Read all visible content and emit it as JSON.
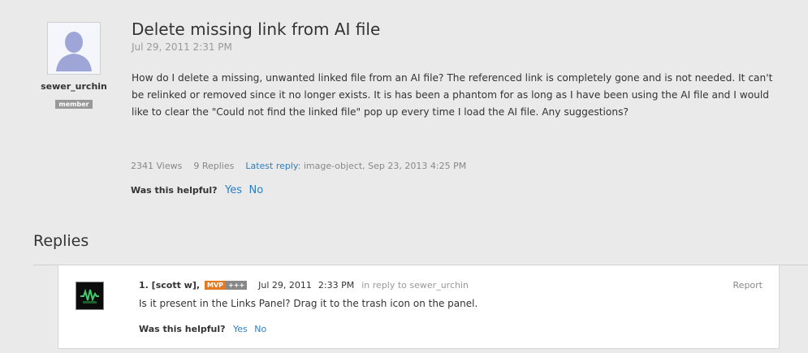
{
  "question": {
    "author": "sewer_urchin",
    "role_badge": "member",
    "title": "Delete missing link from AI file",
    "date": "Jul 29, 2011 2:31 PM",
    "body": "How do I delete a missing, unwanted linked file from an AI file? The referenced link is completely gone and is not needed. It can't be relinked or removed since it no longer exists. It is has been a phantom for as long as I have been using the AI file and I would like to clear the \"Could not find the linked file\" pop up every time I load the AI file. Any suggestions?",
    "views": "2341 Views",
    "replies_count": "9 Replies",
    "latest_reply_label": "Latest reply",
    "latest_reply_text": ": image-object, Sep 23, 2013 4:25 PM",
    "helpful_label": "Was this helpful?",
    "yes_label": "Yes",
    "no_label": "No"
  },
  "replies_section": {
    "heading": "Replies"
  },
  "reply": {
    "author": "1. [scott w],",
    "badge_mvp": "MVP",
    "badge_plus": "+++",
    "date": "Jul 29, 2011",
    "time": "2:33 PM",
    "in_reply_to": "in reply to sewer_urchin",
    "report_label": "Report",
    "body": "Is it present in the Links Panel? Drag it to the trash icon on the panel.",
    "helpful_label": "Was this helpful?",
    "yes_label": "Yes",
    "no_label": "No"
  },
  "colors": {
    "link": "#2c7fc2",
    "mvp_badge": "#e37a23",
    "background": "#eaeaea"
  }
}
